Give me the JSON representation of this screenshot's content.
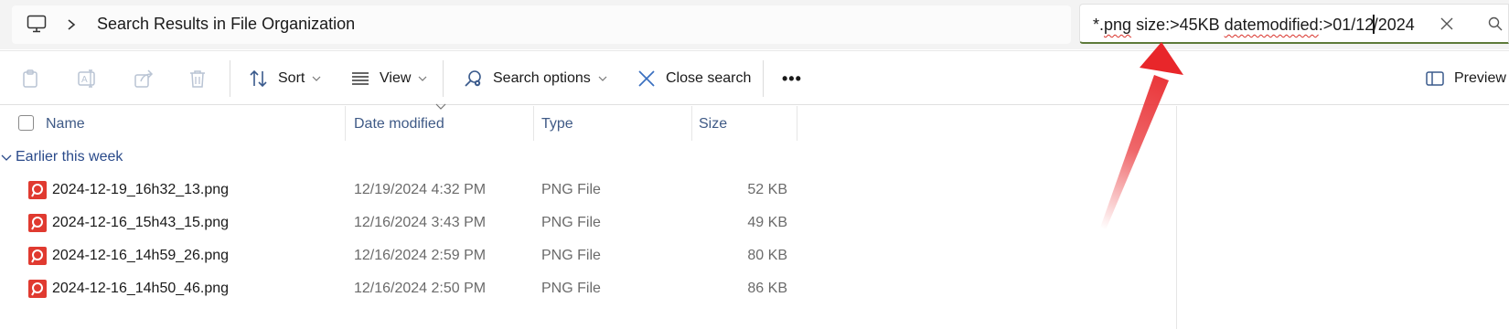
{
  "address_bar": {
    "breadcrumb": "Search Results in File Organization",
    "search_query": {
      "part1": "*.",
      "part2": "png",
      "part3": " size:>45KB ",
      "part4": "datemodified",
      "part5": ":>01/12",
      "part6": "/2024"
    }
  },
  "toolbar": {
    "sort_label": "Sort",
    "view_label": "View",
    "search_options_label": "Search options",
    "close_search_label": "Close search",
    "more_label": "•••",
    "preview_label": "Preview"
  },
  "columns": {
    "name": "Name",
    "date_modified": "Date modified",
    "type": "Type",
    "size": "Size"
  },
  "group": {
    "label": "Earlier this week"
  },
  "files": [
    {
      "name": "2024-12-19_16h32_13.png",
      "date": "12/19/2024 4:32 PM",
      "type": "PNG File",
      "size": "52 KB"
    },
    {
      "name": "2024-12-16_15h43_15.png",
      "date": "12/16/2024 3:43 PM",
      "type": "PNG File",
      "size": "49 KB"
    },
    {
      "name": "2024-12-16_14h59_26.png",
      "date": "12/16/2024 2:59 PM",
      "type": "PNG File",
      "size": "80 KB"
    },
    {
      "name": "2024-12-16_14h50_46.png",
      "date": "12/16/2024 2:50 PM",
      "type": "PNG File",
      "size": "86 KB"
    }
  ],
  "colors": {
    "annotation_arrow": "#e8262a",
    "file_icon": "#e03a30",
    "search_underline": "#5e7a3a",
    "header_text": "#3f5a86"
  }
}
